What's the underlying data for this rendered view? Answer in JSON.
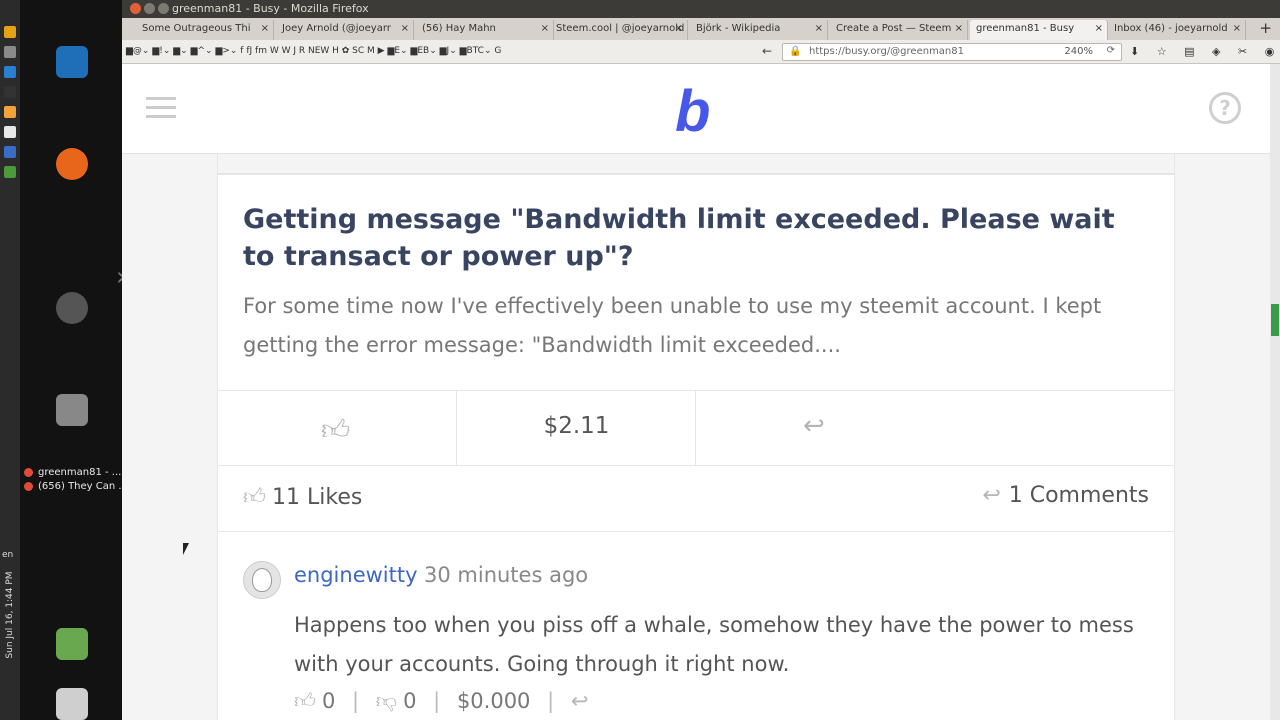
{
  "window": {
    "title": "greenman81 - Busy - Mozilla Firefox",
    "btn_colors": [
      "#e0603a",
      "#7d7a72",
      "#7d7a72"
    ]
  },
  "os_panel": {
    "items": [
      {
        "name": "app-1-icon",
        "color": "#e3a21a"
      },
      {
        "name": "app-2-icon",
        "color": "#8a8a8a"
      },
      {
        "name": "app-3-icon",
        "color": "#2a7fd4"
      },
      {
        "name": "app-4-icon",
        "color": "#333"
      },
      {
        "name": "app-5-icon",
        "color": "#f2a33a"
      },
      {
        "name": "app-6-icon",
        "color": "#e8e8e8"
      },
      {
        "name": "app-7-icon",
        "color": "#3a6cc8"
      },
      {
        "name": "app-8-icon",
        "color": "#4c9a3c"
      }
    ],
    "lang": "en",
    "clock": "Sun Jul 16, 1:44 PM"
  },
  "launcher": {
    "icons": [
      {
        "name": "libreoffice-writer-icon",
        "color": "#1f6fb8"
      },
      {
        "name": "firefox-icon",
        "color": "#e8661c"
      },
      {
        "name": "ubuntu-icon",
        "color": "#555"
      },
      {
        "name": "files-icon",
        "color": "#888"
      },
      {
        "name": "workspace-icon",
        "color": "#6aa84f"
      },
      {
        "name": "trash-icon",
        "color": "#cfcfcf"
      }
    ],
    "tasks": [
      {
        "label": "greenman81 - ..."
      },
      {
        "label": "(656) They Can ..."
      }
    ]
  },
  "tabs": [
    {
      "label": "Some Outrageous Thi"
    },
    {
      "label": "Joey Arnold (@joeyarr"
    },
    {
      "label": "(56) Hay Mahn"
    },
    {
      "label": "Steem.cool | @joeyarnold"
    },
    {
      "label": "Björk - Wikipedia"
    },
    {
      "label": "Create a Post — Steem"
    },
    {
      "label": "greenman81 - Busy"
    },
    {
      "label": "Inbox (46) - joeyarnold"
    }
  ],
  "bookmarks": "▆@⌄ ▆!⌄ ▆⌄ ▆^⌄ ▆>⌄ f fJ fm W W J R NEW H ✿ SC M ▶ ▆E⌄ ▆EB⌄ ▆J⌄ ▆BTC⌄ G",
  "address_bar": {
    "url": "https://busy.org/@greenman81",
    "zoom": "240%"
  },
  "busy": {
    "logo": "b",
    "post": {
      "title": "Getting message \"Bandwidth limit exceeded. Please wait to transact or power up\"?",
      "excerpt": "For some time now I've effectively been unable to use my steemit account. I kept getting the error message: \"Bandwidth limit exceeded....",
      "payout": "$2.11",
      "likes": "11 Likes",
      "comments": "1 Comments"
    },
    "comment": {
      "author": "enginewitty",
      "time": "30 minutes ago",
      "body": "Happens too when you piss off a whale, somehow they have the power to mess with your accounts. Going through it right now.",
      "upvotes": "0",
      "downvotes": "0",
      "payout": "$0.000"
    }
  },
  "colors": {
    "accent": "#4757e8",
    "link": "#3d67c5",
    "scroll_thumb": "#3a9a4c"
  }
}
